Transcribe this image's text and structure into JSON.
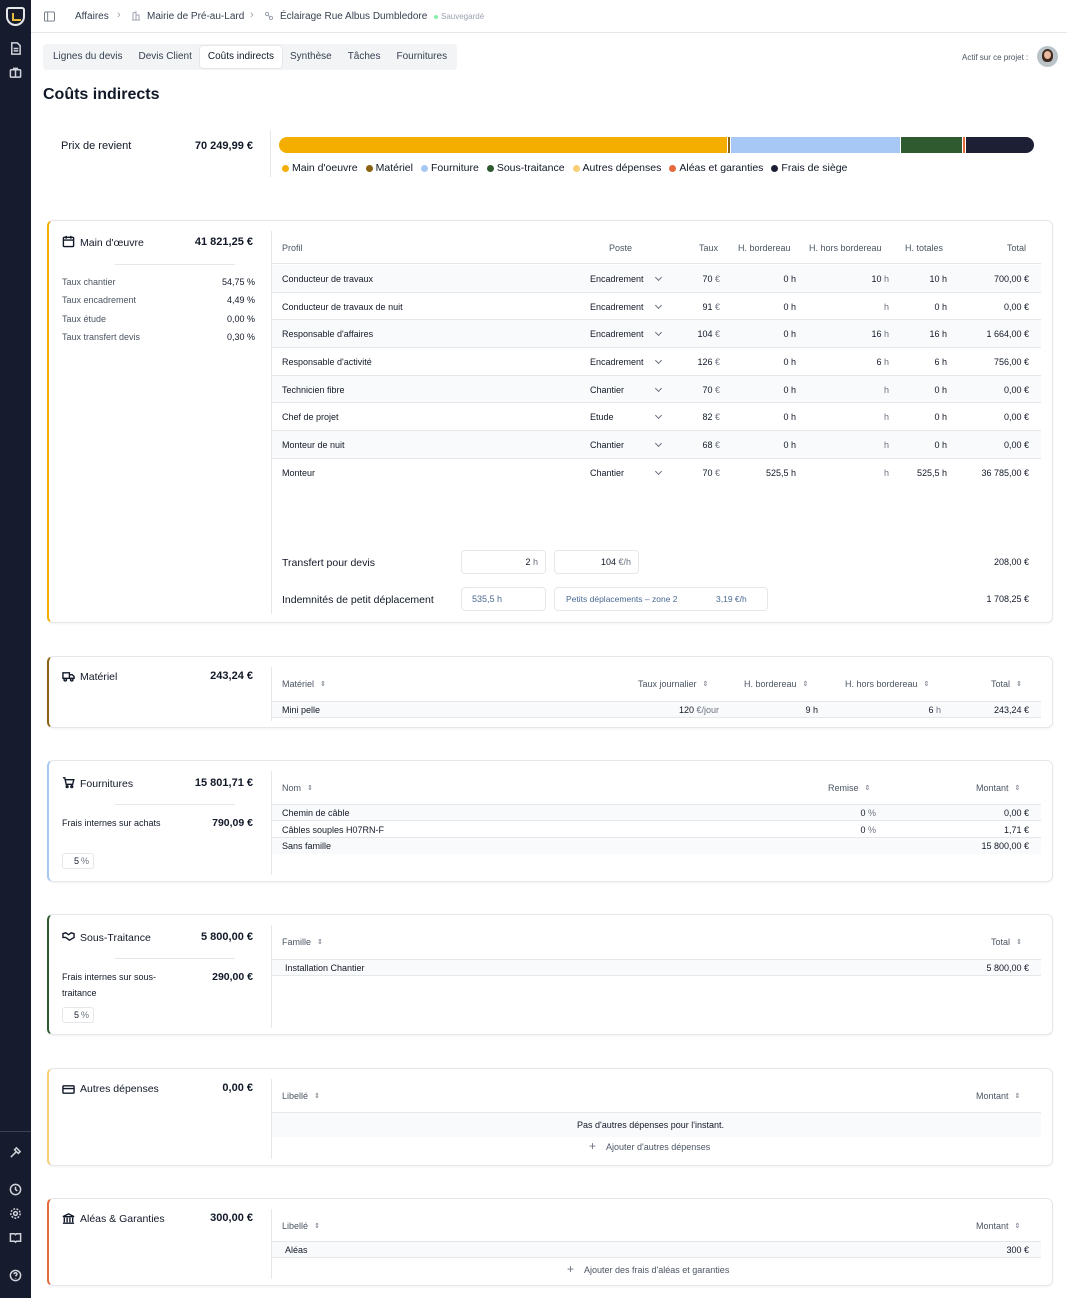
{
  "breadcrumb": {
    "affaires": "Affaires",
    "client": "Mairie de Pré-au-Lard",
    "project": "Éclairage Rue Albus Dumbledore",
    "saved": "Sauvegardé"
  },
  "tabs": [
    {
      "label": "Lignes du devis"
    },
    {
      "label": "Devis Client"
    },
    {
      "label": "Coûts indirects",
      "active": true
    },
    {
      "label": "Synthèse"
    },
    {
      "label": "Tâches"
    },
    {
      "label": "Fournitures"
    }
  ],
  "active_on_project": "Actif sur ce projet :",
  "page_title": "Coûts indirects",
  "prix_revient": {
    "label": "Prix de revient",
    "value": "70 249,99 €",
    "segments": [
      {
        "name": "Main d'oeuvre",
        "value": 41821.25,
        "color": "#f3ae00"
      },
      {
        "name": "Matériel",
        "value": 243.24,
        "color": "#8a6212"
      },
      {
        "name": "Fourniture",
        "value": 15801.71,
        "color": "#a7c7f5"
      },
      {
        "name": "Sous-traitance",
        "value": 5800.0,
        "color": "#2f5a30"
      },
      {
        "name": "Autres dépenses",
        "value": 0,
        "color": "#f8cf75"
      },
      {
        "name": "Aléas et garanties",
        "value": 300.0,
        "color": "#e46a3e"
      },
      {
        "name": "Frais de siège",
        "value": 6283.79,
        "color": "#1d2035"
      }
    ]
  },
  "mo": {
    "title": "Main d'œuvre",
    "total": "41 821,25 €",
    "rates": [
      {
        "label": "Taux chantier",
        "value": "54,75 %"
      },
      {
        "label": "Taux encadrement",
        "value": "4,49 %"
      },
      {
        "label": "Taux étude",
        "value": "0,00 %"
      },
      {
        "label": "Taux transfert devis",
        "value": "0,30 %"
      }
    ],
    "headers": {
      "profil": "Profil",
      "poste": "Poste",
      "taux": "Taux",
      "hb": "H. bordereau",
      "hhb": "H. hors bordereau",
      "ht": "H. totales",
      "total": "Total"
    },
    "rows": [
      {
        "profil": "Conducteur de travaux",
        "poste": "Encadrement",
        "taux": "70",
        "hb": "0 h",
        "hhb": "10",
        "ht": "10 h",
        "total": "700,00 €"
      },
      {
        "profil": "Conducteur de travaux de nuit",
        "poste": "Encadrement",
        "taux": "91",
        "hb": "0 h",
        "hhb": "",
        "ht": "0 h",
        "total": "0,00 €"
      },
      {
        "profil": "Responsable d'affaires",
        "poste": "Encadrement",
        "taux": "104",
        "hb": "0 h",
        "hhb": "16",
        "ht": "16 h",
        "total": "1 664,00 €"
      },
      {
        "profil": "Responsable d'activité",
        "poste": "Encadrement",
        "taux": "126",
        "hb": "0 h",
        "hhb": "6",
        "ht": "6 h",
        "total": "756,00 €"
      },
      {
        "profil": "Technicien fibre",
        "poste": "Chantier",
        "taux": "70",
        "hb": "0 h",
        "hhb": "",
        "ht": "0 h",
        "total": "0,00 €"
      },
      {
        "profil": "Chef de projet",
        "poste": "Etude",
        "taux": "82",
        "hb": "0 h",
        "hhb": "",
        "ht": "0 h",
        "total": "0,00 €"
      },
      {
        "profil": "Monteur de nuit",
        "poste": "Chantier",
        "taux": "68",
        "hb": "0 h",
        "hhb": "",
        "ht": "0 h",
        "total": "0,00 €"
      },
      {
        "profil": "Monteur",
        "poste": "Chantier",
        "taux": "70",
        "hb": "525,5 h",
        "hhb": "",
        "ht": "525,5 h",
        "total": "36 785,00 €"
      }
    ],
    "units": {
      "euro": "€",
      "h": "h",
      "eur_h": "€/h"
    },
    "transfert": {
      "label": "Transfert pour devis",
      "hours": "2",
      "rate": "104",
      "total": "208,00 €"
    },
    "indemnites": {
      "label": "Indemnités de petit déplacement",
      "hours": "535,5 h",
      "zone": "Petits déplacements – zone 2",
      "rate": "3,19 €/h",
      "total": "1 708,25 €"
    }
  },
  "materiel": {
    "title": "Matériel",
    "total": "243,24 €",
    "headers": {
      "name": "Matériel",
      "taux": "Taux journalier",
      "hb": "H. bordereau",
      "hhb": "H. hors bordereau",
      "total": "Total"
    },
    "rows": [
      {
        "name": "Mini pelle",
        "taux": "120",
        "taux_unit": "€/jour",
        "hb": "9 h",
        "hhb": "6",
        "total": "243,24 €"
      }
    ]
  },
  "fournitures": {
    "title": "Fournitures",
    "total": "15 801,71 €",
    "frais_label": "Frais internes sur achats",
    "frais_value": "790,09 €",
    "pct": "5",
    "pct_unit": "%",
    "headers": {
      "nom": "Nom",
      "remise": "Remise",
      "montant": "Montant"
    },
    "rows": [
      {
        "nom": "Chemin de câble",
        "remise": "0",
        "montant": "0,00 €"
      },
      {
        "nom": "Câbles souples H07RN-F",
        "remise": "0",
        "montant": "1,71 €"
      },
      {
        "nom": "Sans famille",
        "remise": "",
        "montant": "15 800,00 €"
      }
    ]
  },
  "sous_traitance": {
    "title": "Sous-Traitance",
    "total": "5 800,00 €",
    "frais_label": "Frais internes sur sous-traitance",
    "frais_value": "290,00 €",
    "pct": "5",
    "pct_unit": "%",
    "headers": {
      "famille": "Famille",
      "total": "Total"
    },
    "rows": [
      {
        "famille": "Installation Chantier",
        "total": "5 800,00 €"
      }
    ]
  },
  "autres": {
    "title": "Autres dépenses",
    "total": "0,00 €",
    "headers": {
      "libelle": "Libellé",
      "montant": "Montant"
    },
    "empty": "Pas d'autres dépenses pour l'instant.",
    "add": "Ajouter d'autres dépenses"
  },
  "aleas": {
    "title": "Aléas & Garanties",
    "total": "300,00 €",
    "headers": {
      "libelle": "Libellé",
      "montant": "Montant"
    },
    "rows": [
      {
        "libelle": "Aléas",
        "montant": "300 €"
      }
    ],
    "add": "Ajouter des frais d'aléas et garanties"
  }
}
